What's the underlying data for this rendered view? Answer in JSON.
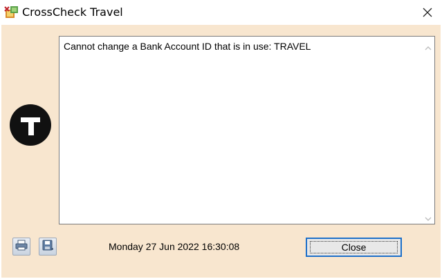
{
  "window": {
    "title": "CrossCheck Travel",
    "app_icon": "crosscheck-app-icon",
    "close_icon": "close-icon"
  },
  "message": {
    "text": "Cannot change a Bank Account ID that is in use: TRAVEL"
  },
  "footer": {
    "print_icon": "print-icon",
    "save_icon": "save-icon",
    "datetime": "Monday 27 Jun 2022 16:30:08",
    "close_label": "Close"
  },
  "colors": {
    "panel_background": "#f8e6cf",
    "focus_border": "#1c6fc9",
    "logo": "#111111"
  }
}
